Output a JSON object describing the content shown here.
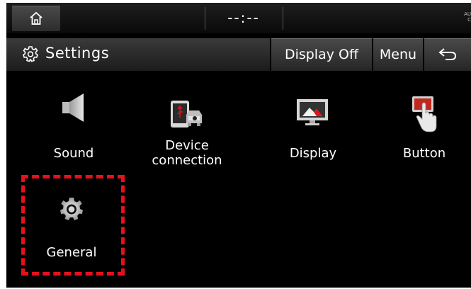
{
  "status_bar": {
    "home_icon": "home-icon",
    "clock": "--:--",
    "corner_text": "AU\nC"
  },
  "title_bar": {
    "icon": "gear-icon",
    "title": "Settings",
    "display_off_label": "Display Off",
    "menu_label": "Menu",
    "back_icon": "back-arrow-icon"
  },
  "items": [
    {
      "label": "Sound",
      "icon": "speaker-icon"
    },
    {
      "label": "Device connection",
      "icon": "phone-car-icon"
    },
    {
      "label": "Display",
      "icon": "display-icon"
    },
    {
      "label": "Button",
      "icon": "hand-press-icon"
    },
    {
      "label": "General",
      "icon": "gear-icon"
    }
  ],
  "highlight_color": "#e8101a"
}
